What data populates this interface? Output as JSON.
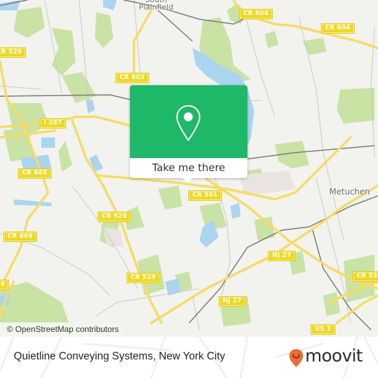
{
  "map": {
    "colors": {
      "background": "#f2f2ef",
      "park": "#c9e3a5",
      "water": "#a9d5ef",
      "road_major": "#f5dc63",
      "road_minor": "#c8c8c8",
      "rail": "#7a7a7a",
      "industrial": "#e9e4e0"
    },
    "place_labels": [
      {
        "id": "south-plainfield",
        "lines": [
          "South",
          "Plainfield"
        ]
      },
      {
        "id": "metuchen",
        "text": "Metuchen"
      }
    ],
    "road_labels": [
      {
        "id": "cr-604-a",
        "text": "CR 604"
      },
      {
        "id": "cr-604-b",
        "text": "CR 604"
      },
      {
        "id": "cr-529-top",
        "text": "CR 529"
      },
      {
        "id": "cr-603",
        "text": "CR 603"
      },
      {
        "id": "i-287",
        "text": "I 287"
      },
      {
        "id": "cr-665",
        "text": "CR 665"
      },
      {
        "id": "cr-501",
        "text": "CR 501"
      },
      {
        "id": "cr-529-mid",
        "text": "CR 529"
      },
      {
        "id": "cr-609",
        "text": "CR 609"
      },
      {
        "id": "cr-529-low",
        "text": "CR 529"
      },
      {
        "id": "nj-27-a",
        "text": "NJ 27"
      },
      {
        "id": "nj-27-b",
        "text": "NJ 27"
      },
      {
        "id": "cr-53x",
        "text": "CR 53"
      },
      {
        "id": "cr-x8",
        "text": "8"
      },
      {
        "id": "us-1",
        "text": "US 1"
      }
    ],
    "popup": {
      "icon": "map-pin-icon",
      "button_label": "Take me there",
      "color": "#1eb869"
    },
    "attribution": "© OpenStreetMap contributors"
  },
  "footer": {
    "title": "Quietline Conveying Systems, New York City",
    "brand": {
      "name": "moovit",
      "icon": "moovit-smile-pin-icon",
      "color": "#f26a31"
    }
  }
}
